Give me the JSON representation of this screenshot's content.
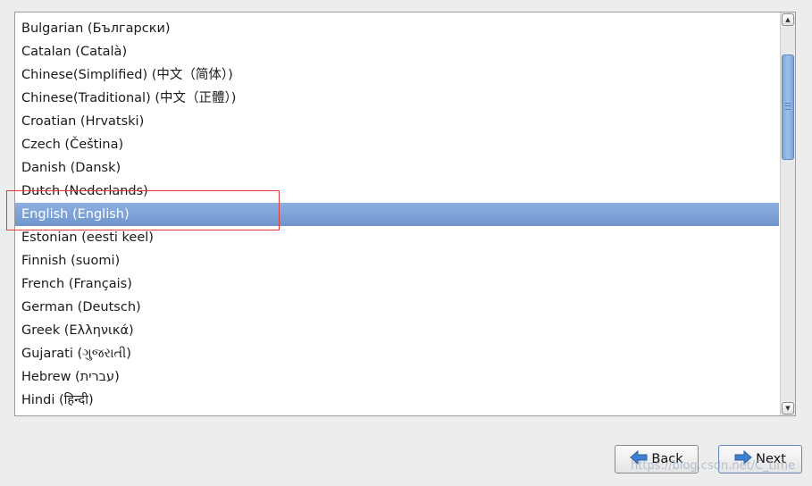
{
  "language_list": {
    "items": [
      "Bulgarian (Български)",
      "Catalan (Català)",
      "Chinese(Simplified) (中文（简体）)",
      "Chinese(Traditional) (中文（正體）)",
      "Croatian (Hrvatski)",
      "Czech (Čeština)",
      "Danish (Dansk)",
      "Dutch (Nederlands)",
      "English (English)",
      "Estonian (eesti keel)",
      "Finnish (suomi)",
      "French (Français)",
      "German (Deutsch)",
      "Greek (Ελληνικά)",
      "Gujarati (ગુજરાતી)",
      "Hebrew (עברית)",
      "Hindi (हिन्दी)"
    ],
    "selected": "English (English)"
  },
  "buttons": {
    "back_label": "Back",
    "next_label": "Next"
  },
  "icons": {
    "back": "arrow-left-icon",
    "next": "arrow-right-icon",
    "scroll_up": "chevron-up-icon",
    "scroll_down": "chevron-down-icon"
  },
  "colors": {
    "selection": "#7a9fd6",
    "annotation_box": "#e53b3b",
    "arrow_icon": "#3f7fd0"
  },
  "watermark": "https://blog.csdn.net/C_time"
}
